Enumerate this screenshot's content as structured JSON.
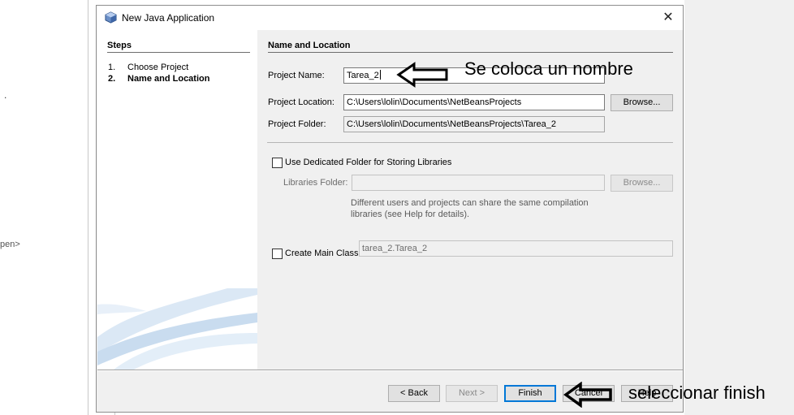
{
  "background": {
    "dot": ".",
    "open_fragment": "pen>"
  },
  "dialog": {
    "title": "New Java Application",
    "close_label": "✕",
    "steps": {
      "heading": "Steps",
      "items": [
        {
          "num": "1.",
          "label": "Choose Project"
        },
        {
          "num": "2.",
          "label": "Name and Location"
        }
      ]
    },
    "section_title": "Name and Location",
    "project_name": {
      "label": "Project Name:",
      "value": "Tarea_2"
    },
    "project_location": {
      "label": "Project Location:",
      "value": "C:\\Users\\lolin\\Documents\\NetBeansProjects",
      "browse": "Browse..."
    },
    "project_folder": {
      "label": "Project Folder:",
      "value": "C:\\Users\\lolin\\Documents\\NetBeansProjects\\Tarea_2"
    },
    "dedicated_folder": {
      "label": "Use Dedicated Folder for Storing Libraries",
      "checked": false
    },
    "libraries_folder": {
      "label": "Libraries Folder:",
      "value": "",
      "browse": "Browse..."
    },
    "help_text": [
      "Different users and projects can share the same compilation",
      "libraries (see Help for details)."
    ],
    "main_class": {
      "label": "Create Main Class",
      "value": "tarea_2.Tarea_2",
      "checked": false
    },
    "buttons": {
      "back": "< Back",
      "next": "Next >",
      "finish": "Finish",
      "cancel": "Cancel",
      "help": "Help"
    }
  },
  "annotations": {
    "name_hint": "Se coloca un nombre",
    "finish_hint": "seleccionar finish"
  },
  "colors": {
    "dialog_bg": "#f0f0f0",
    "default_button_border": "#0078d7",
    "art_blue": "#c8dcef"
  }
}
